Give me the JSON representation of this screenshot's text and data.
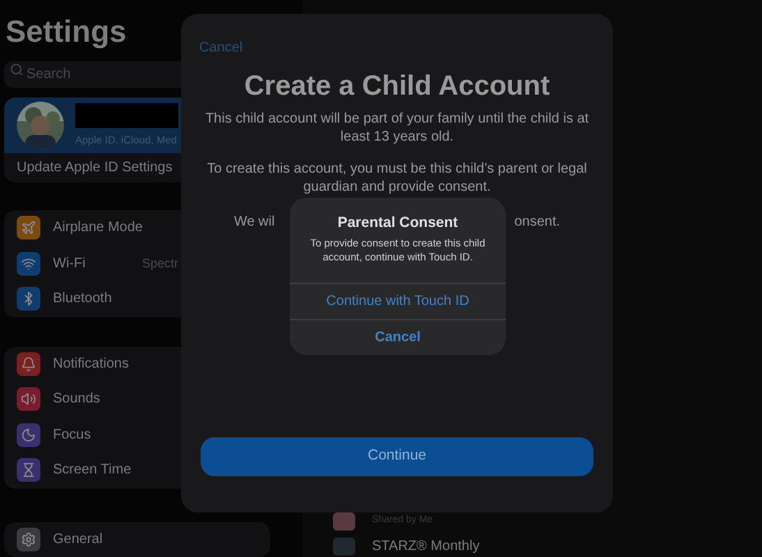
{
  "sidebar": {
    "title": "Settings",
    "search": {
      "placeholder": "Search"
    },
    "profile": {
      "subtitle": "Apple ID, iCloud, Med"
    },
    "update_row": "Update Apple ID Settings",
    "groups": [
      [
        {
          "label": "Airplane Mode",
          "color": "#7a4a12"
        },
        {
          "label": "Wi-Fi",
          "value": "Spectr",
          "color": "#0f3d70"
        },
        {
          "label": "Bluetooth",
          "color": "#0f3d70"
        }
      ],
      [
        {
          "label": "Notifications",
          "color": "#7a2020"
        },
        {
          "label": "Sounds",
          "color": "#7a1c30"
        },
        {
          "label": "Focus",
          "color": "#3a306e"
        },
        {
          "label": "Screen Time",
          "color": "#3a306e"
        }
      ],
      [
        {
          "label": "General",
          "color": "#3c3c3e"
        }
      ]
    ]
  },
  "content": {
    "rows": [
      {
        "subtitle": "Shared by Me"
      },
      {
        "title": "STARZ® Monthly"
      }
    ]
  },
  "sheet": {
    "cancel": "Cancel",
    "title": "Create a Child Account",
    "paragraphs": [
      "This child account will be part of your family until the child is at least 13 years old.",
      "To create this account, you must be this child’s parent or legal guardian and provide consent."
    ],
    "partial_paragraph": [
      "We wil",
      "onsent."
    ],
    "continue": "Continue"
  },
  "alert": {
    "title": "Parental Consent",
    "message": "To provide consent to create this child account, continue with Touch ID.",
    "actions": [
      {
        "label": "Continue with Touch ID",
        "bold": false
      },
      {
        "label": "Cancel",
        "bold": true
      }
    ]
  }
}
